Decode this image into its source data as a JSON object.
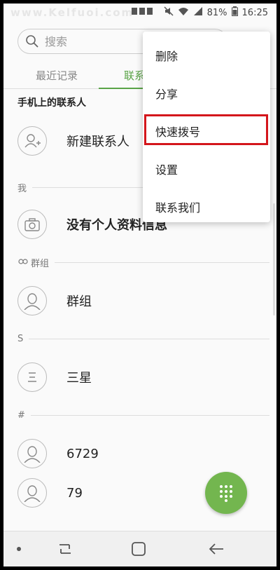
{
  "status_bar": {
    "watermark": "www.Kelfuoi.com",
    "battery": "81%",
    "time": "16:25"
  },
  "search": {
    "placeholder": "搜索"
  },
  "tabs": {
    "recent": "最近记录",
    "contacts": "联系"
  },
  "section_title": "手机上的联系人",
  "contacts": {
    "new_contact": "新建联系人",
    "me_header": "我",
    "no_profile": "没有个人资料信息",
    "groups_header": "群组",
    "groups_item": "群组",
    "s_header": "S",
    "samsung": "三星",
    "hash_header": "#",
    "contact_6729": "6729",
    "contact_79": "79"
  },
  "menu": {
    "items": [
      "删除",
      "分享",
      "快速拨号",
      "设置",
      "联系我们"
    ],
    "highlighted": "快速拨号"
  },
  "colors": {
    "accent": "#5aa447",
    "fab": "#73b64f",
    "highlight_border": "#d4161c"
  }
}
